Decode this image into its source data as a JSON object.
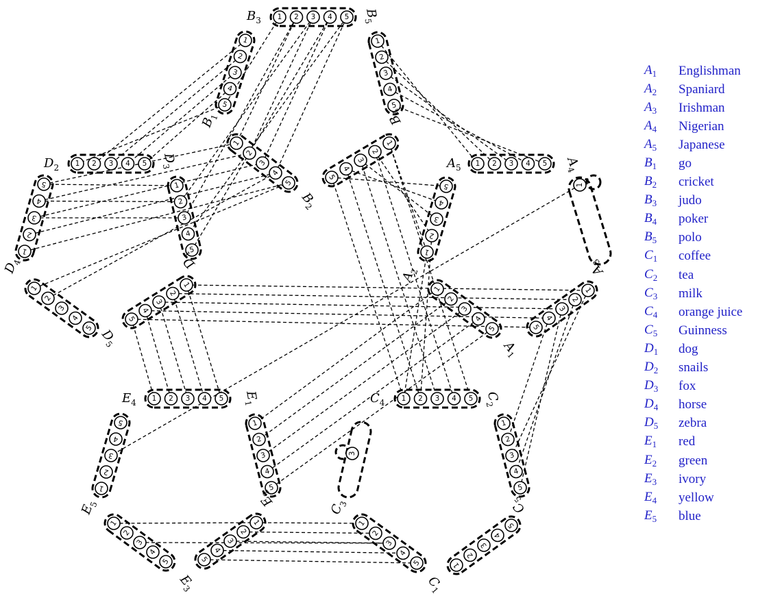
{
  "legend": [
    {
      "letter": "A",
      "index": "1",
      "label": "Englishman"
    },
    {
      "letter": "A",
      "index": "2",
      "label": "Spaniard"
    },
    {
      "letter": "A",
      "index": "3",
      "label": "Irishman"
    },
    {
      "letter": "A",
      "index": "4",
      "label": "Nigerian"
    },
    {
      "letter": "A",
      "index": "5",
      "label": "Japanese"
    },
    {
      "letter": "B",
      "index": "1",
      "label": "go"
    },
    {
      "letter": "B",
      "index": "2",
      "label": "cricket"
    },
    {
      "letter": "B",
      "index": "3",
      "label": "judo"
    },
    {
      "letter": "B",
      "index": "4",
      "label": "poker"
    },
    {
      "letter": "B",
      "index": "5",
      "label": "polo"
    },
    {
      "letter": "C",
      "index": "1",
      "label": "coffee"
    },
    {
      "letter": "C",
      "index": "2",
      "label": "tea"
    },
    {
      "letter": "C",
      "index": "3",
      "label": "milk"
    },
    {
      "letter": "C",
      "index": "4",
      "label": "orange juice"
    },
    {
      "letter": "C",
      "index": "5",
      "label": "Guinness"
    },
    {
      "letter": "D",
      "index": "1",
      "label": "dog"
    },
    {
      "letter": "D",
      "index": "2",
      "label": "snails"
    },
    {
      "letter": "D",
      "index": "3",
      "label": "fox"
    },
    {
      "letter": "D",
      "index": "4",
      "label": "horse"
    },
    {
      "letter": "D",
      "index": "5",
      "label": "zebra"
    },
    {
      "letter": "E",
      "index": "1",
      "label": "red"
    },
    {
      "letter": "E",
      "index": "2",
      "label": "green"
    },
    {
      "letter": "E",
      "index": "3",
      "label": "ivory"
    },
    {
      "letter": "E",
      "index": "4",
      "label": "yellow"
    },
    {
      "letter": "E",
      "index": "5",
      "label": "blue"
    }
  ],
  "legend_color": "#2222c8",
  "groups": [
    {
      "id": "B3",
      "letter": "B",
      "index": "3",
      "nodes": [
        "1",
        "2",
        "3",
        "4",
        "5"
      ]
    },
    {
      "id": "B5",
      "letter": "B",
      "index": "5",
      "nodes": [
        "1",
        "2",
        "3",
        "4",
        "5"
      ]
    },
    {
      "id": "B1",
      "letter": "B",
      "index": "1",
      "nodes": [
        "1",
        "2",
        "3",
        "4",
        "5"
      ]
    },
    {
      "id": "D2",
      "letter": "D",
      "index": "2",
      "nodes": [
        "1",
        "2",
        "3",
        "4",
        "5"
      ]
    },
    {
      "id": "D3",
      "letter": "D",
      "index": "3",
      "nodes": [
        "1",
        "2",
        "3",
        "4",
        "5"
      ]
    },
    {
      "id": "B2",
      "letter": "B",
      "index": "2",
      "nodes": [
        "1",
        "2",
        "3",
        "4",
        "5"
      ]
    },
    {
      "id": "B4",
      "letter": "B",
      "index": "4",
      "nodes": [
        "1",
        "2",
        "3",
        "4",
        "5"
      ]
    },
    {
      "id": "A5",
      "letter": "A",
      "index": "5",
      "nodes": [
        "1",
        "2",
        "3",
        "4",
        "5"
      ]
    },
    {
      "id": "A4",
      "letter": "A",
      "index": "4",
      "nodes": [
        "1"
      ]
    },
    {
      "id": "D4",
      "letter": "D",
      "index": "4",
      "nodes": [
        "1",
        "2",
        "3",
        "4",
        "5"
      ]
    },
    {
      "id": "A2",
      "letter": "A",
      "index": "2",
      "nodes": [
        "1",
        "2",
        "3",
        "4",
        "5"
      ]
    },
    {
      "id": "D1",
      "letter": "D",
      "index": "1",
      "nodes": [
        "1",
        "2",
        "3",
        "4",
        "5"
      ]
    },
    {
      "id": "D5",
      "letter": "D",
      "index": "5",
      "nodes": [
        "1",
        "2",
        "3",
        "4",
        "5"
      ]
    },
    {
      "id": "A1",
      "letter": "A",
      "index": "1",
      "nodes": [
        "1",
        "2",
        "3",
        "4",
        "5"
      ]
    },
    {
      "id": "A3",
      "letter": "A",
      "index": "3",
      "nodes": [
        "1",
        "2",
        "3",
        "4",
        "5"
      ]
    },
    {
      "id": "E4",
      "letter": "E",
      "index": "4",
      "nodes": [
        "1",
        "2",
        "3",
        "4",
        "5"
      ]
    },
    {
      "id": "E1",
      "letter": "E",
      "index": "1",
      "nodes": [
        "1",
        "2",
        "3",
        "4",
        "5"
      ]
    },
    {
      "id": "C4",
      "letter": "C",
      "index": "4",
      "nodes": [
        "1",
        "2",
        "3",
        "4",
        "5"
      ]
    },
    {
      "id": "C2",
      "letter": "C",
      "index": "2",
      "nodes": [
        "1",
        "2",
        "3",
        "4",
        "5"
      ]
    },
    {
      "id": "E5",
      "letter": "E",
      "index": "5",
      "nodes": [
        "1",
        "2",
        "3",
        "4",
        "5"
      ]
    },
    {
      "id": "C3",
      "letter": "C",
      "index": "3",
      "nodes": [
        "3"
      ]
    },
    {
      "id": "E2",
      "letter": "E",
      "index": "2",
      "nodes": [
        "1",
        "2",
        "3",
        "4",
        "5"
      ]
    },
    {
      "id": "E3",
      "letter": "E",
      "index": "3",
      "nodes": [
        "1",
        "2",
        "3",
        "4",
        "5"
      ]
    },
    {
      "id": "C1",
      "letter": "C",
      "index": "1",
      "nodes": [
        "1",
        "2",
        "3",
        "4",
        "5"
      ]
    },
    {
      "id": "C5",
      "letter": "C",
      "index": "5",
      "nodes": [
        "1",
        "2",
        "3",
        "4",
        "5"
      ]
    }
  ],
  "edges": [
    [
      "B3.1",
      "B1.5"
    ],
    [
      "B3.2",
      "B2.1"
    ],
    [
      "B3.3",
      "B2.2"
    ],
    [
      "B3.4",
      "D3.5"
    ],
    [
      "B3.5",
      "D3.4"
    ],
    [
      "B3.2",
      "D3.3"
    ],
    [
      "B3.3",
      "D3.2"
    ],
    [
      "B3.4",
      "B2.3"
    ],
    [
      "B3.5",
      "B2.4"
    ],
    [
      "B1.1",
      "D2.2"
    ],
    [
      "B1.2",
      "D2.3"
    ],
    [
      "B1.3",
      "D2.4"
    ],
    [
      "B1.4",
      "D2.5"
    ],
    [
      "B1.5",
      "D2.1"
    ],
    [
      "B5.1",
      "A5.1"
    ],
    [
      "B5.2",
      "A5.2"
    ],
    [
      "B5.3",
      "A5.3"
    ],
    [
      "B5.4",
      "A5.4"
    ],
    [
      "B5.5",
      "A5.5"
    ],
    [
      "D4.5",
      "B2.1"
    ],
    [
      "D4.4",
      "B2.2"
    ],
    [
      "D4.3",
      "B2.3"
    ],
    [
      "D4.2",
      "B2.4"
    ],
    [
      "D4.1",
      "B2.5"
    ],
    [
      "D4.5",
      "D3.1"
    ],
    [
      "D4.4",
      "D3.2"
    ],
    [
      "D4.3",
      "D3.3"
    ],
    [
      "B4.1",
      "A2.1"
    ],
    [
      "B4.2",
      "A2.2"
    ],
    [
      "B4.3",
      "A2.3"
    ],
    [
      "B4.4",
      "A2.4"
    ],
    [
      "B4.5",
      "A2.5"
    ],
    [
      "B4.1",
      "C4.5"
    ],
    [
      "B4.2",
      "C4.4"
    ],
    [
      "B4.3",
      "C4.3"
    ],
    [
      "B4.4",
      "C4.2"
    ],
    [
      "B4.5",
      "C4.1"
    ],
    [
      "D1.1",
      "A3.1"
    ],
    [
      "D1.2",
      "A3.2"
    ],
    [
      "D1.3",
      "A3.3"
    ],
    [
      "D1.4",
      "A3.4"
    ],
    [
      "D1.5",
      "A3.5"
    ],
    [
      "D1.1",
      "E4.5"
    ],
    [
      "D1.2",
      "E4.4"
    ],
    [
      "D1.3",
      "E4.3"
    ],
    [
      "D1.4",
      "E4.2"
    ],
    [
      "D1.5",
      "E4.1"
    ],
    [
      "D5.1",
      "B2.5"
    ],
    [
      "D5.2",
      "B2.4"
    ],
    [
      "A4.1",
      "E5.3"
    ],
    [
      "A1.1",
      "E1.1"
    ],
    [
      "A1.2",
      "E1.2"
    ],
    [
      "A1.3",
      "E1.3"
    ],
    [
      "A1.4",
      "E1.4"
    ],
    [
      "A1.5",
      "E1.5"
    ],
    [
      "A2.1",
      "C4.1"
    ],
    [
      "A2.2",
      "C4.2"
    ],
    [
      "A3.1",
      "C2.3"
    ],
    [
      "A3.2",
      "C2.4"
    ],
    [
      "A3.3",
      "C2.5"
    ],
    [
      "A3.4",
      "C2.2"
    ],
    [
      "E2.1",
      "C1.1"
    ],
    [
      "E2.2",
      "C1.2"
    ],
    [
      "E2.3",
      "C1.3"
    ],
    [
      "E2.4",
      "C1.4"
    ],
    [
      "E2.5",
      "C1.5"
    ],
    [
      "E3.1",
      "E2.1"
    ],
    [
      "E3.3",
      "C1.3"
    ]
  ]
}
